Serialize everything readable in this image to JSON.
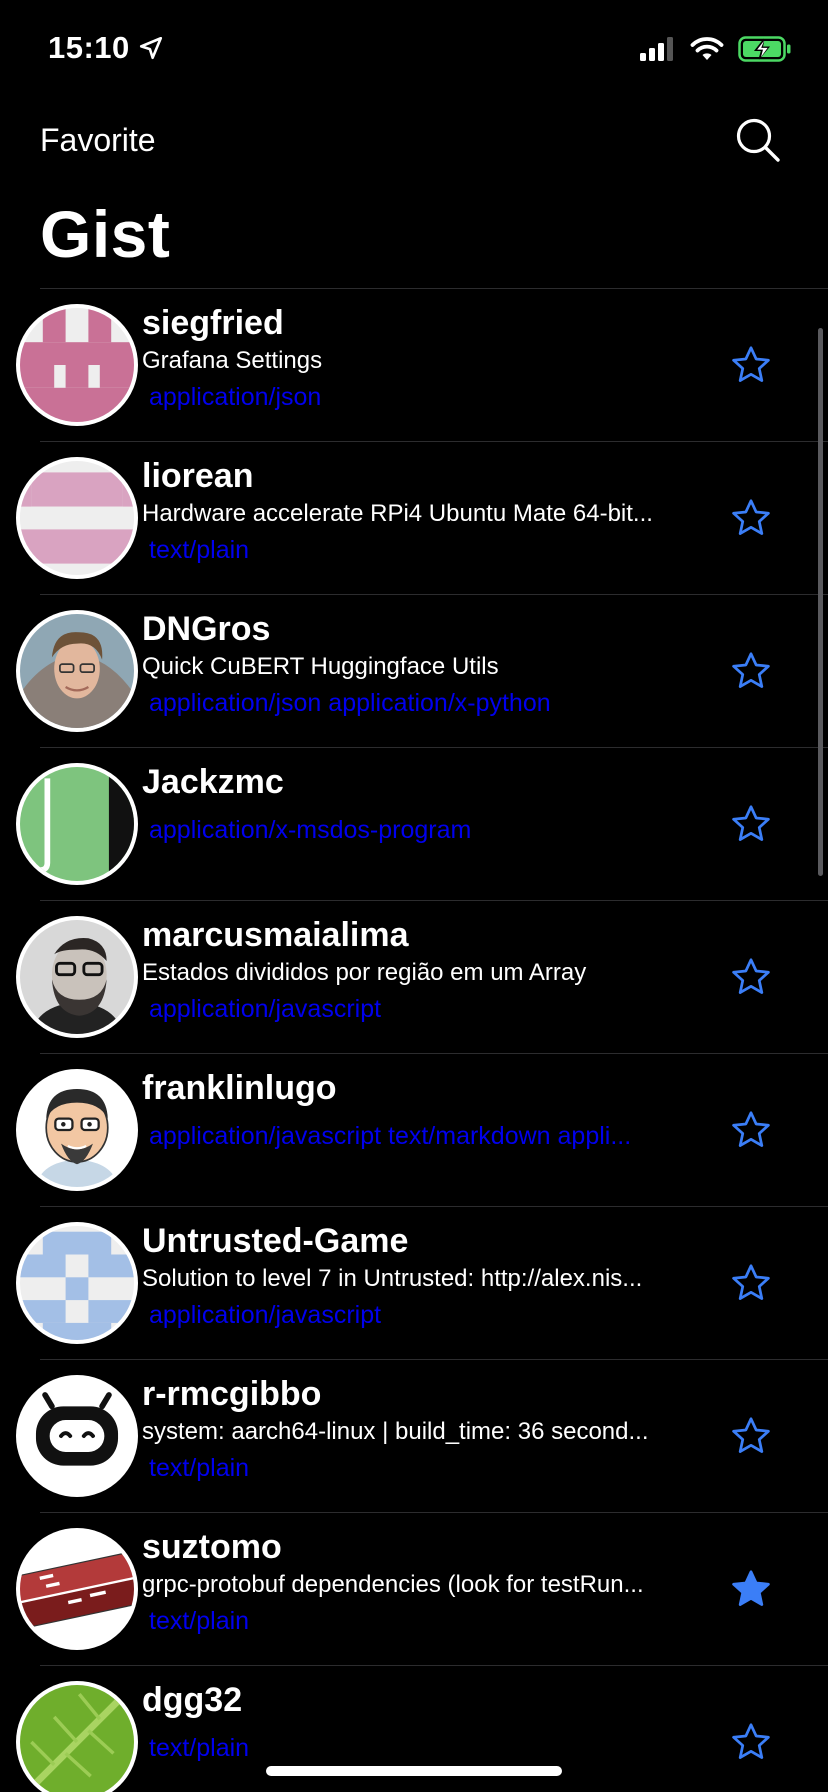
{
  "status_bar": {
    "time": "15:10"
  },
  "nav": {
    "left_label": "Favorite",
    "title": "Gist"
  },
  "colors": {
    "background": "#000000",
    "star": "#3b7ef7",
    "types": "#0000ee",
    "separator": "#2c2c2e",
    "battery": "#4cd964"
  },
  "gists": [
    {
      "owner": "siegfried",
      "description": "Grafana Settings",
      "types": "application/json",
      "favorited": false
    },
    {
      "owner": "liorean",
      "description": "Hardware accelerate RPi4 Ubuntu Mate 64-bit...",
      "types": "text/plain",
      "favorited": false
    },
    {
      "owner": "DNGros",
      "description": "Quick CuBERT Huggingface Utils",
      "types": "application/json application/x-python",
      "favorited": false
    },
    {
      "owner": "Jackzmc",
      "description": "",
      "types": "application/x-msdos-program",
      "favorited": false
    },
    {
      "owner": "marcusmaialima",
      "description": "Estados divididos por região em um Array",
      "types": "application/javascript",
      "favorited": false
    },
    {
      "owner": "franklinlugo",
      "description": "",
      "types": "application/javascript text/markdown appli...",
      "favorited": false
    },
    {
      "owner": "Untrusted-Game",
      "description": "Solution to level 7 in Untrusted: http://alex.nis...",
      "types": "application/javascript",
      "favorited": false
    },
    {
      "owner": "r-rmcgibbo",
      "description": "system: aarch64-linux | build_time: 36 second...",
      "types": "text/plain",
      "favorited": false
    },
    {
      "owner": "suztomo",
      "description": "grpc-protobuf dependencies (look for testRun...",
      "types": "text/plain",
      "favorited": true
    },
    {
      "owner": "dgg32",
      "description": "",
      "types": "text/plain",
      "favorited": false
    }
  ]
}
